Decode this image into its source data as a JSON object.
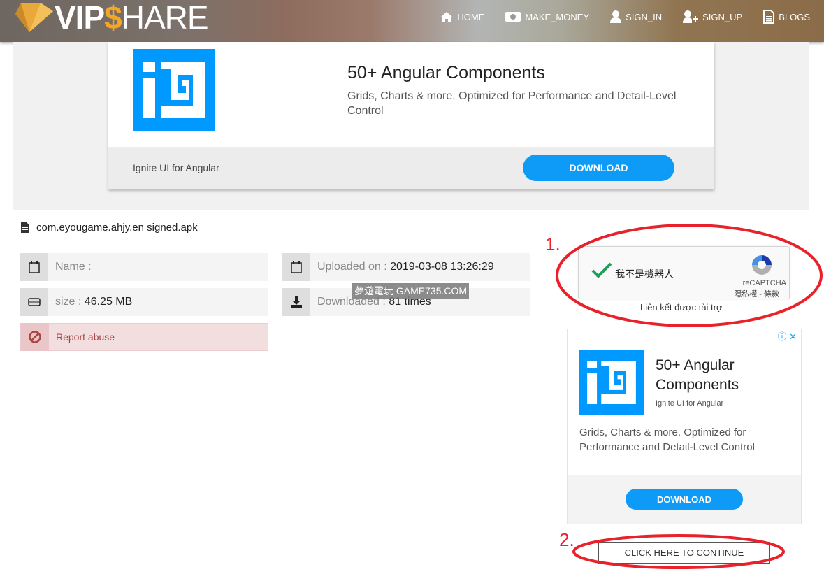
{
  "header": {
    "logo": "VIP$HARE",
    "nav": [
      {
        "label": "HOME",
        "icon": "home-icon"
      },
      {
        "label": "MAKE_MONEY",
        "icon": "money-icon"
      },
      {
        "label": "SIGN_IN",
        "icon": "user-icon"
      },
      {
        "label": "SIGN_UP",
        "icon": "user-plus-icon"
      },
      {
        "label": "BLOGS",
        "icon": "document-icon"
      }
    ]
  },
  "top_ad": {
    "title": "50+ Angular Components",
    "description": "Grids, Charts & more. Optimized for Performance and Detail-Level Control",
    "brand": "Ignite UI for Angular",
    "button": "DOWNLOAD"
  },
  "file": {
    "name": "com.eyougame.ahjy.en signed.apk",
    "name_label": "Name :",
    "size_label": "size :",
    "size": "46.25 MB",
    "uploaded_label": "Uploaded on :",
    "uploaded": "2019-03-08 13:26:29",
    "downloaded_label": "Downloaded :",
    "downloaded": "81 times",
    "report": "Report abuse"
  },
  "watermark": "夢遊電玩 GAME735.COM",
  "captcha": {
    "label": "我不是機器人",
    "brand": "reCAPTCHA",
    "links": "隱私權 - 條款",
    "checked": true
  },
  "sponsored": "Liên kết được tài trợ",
  "side_ad": {
    "title": "50+ Angular Components",
    "brand": "Ignite UI for Angular",
    "description": "Grids, Charts & more. Optimized for Performance and Detail-Level Control",
    "button": "DOWNLOAD"
  },
  "continue_button": "CLICK HERE TO CONTINUE",
  "annotations": {
    "step1": "1.",
    "step2": "2.",
    "color": "#e8212a"
  }
}
